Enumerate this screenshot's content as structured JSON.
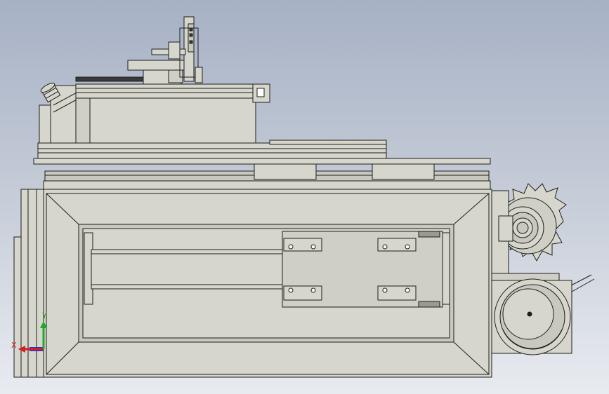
{
  "viewport": {
    "background_top": "#a6b1c5",
    "background_bottom": "#e8ebf0",
    "model_fill": "#d6d6cc",
    "model_edge": "#1e1e1e",
    "model_shade": "#c2c2b8"
  },
  "triad": {
    "x_label": "X",
    "y_label": "Y",
    "x_color": "#d42020",
    "y_color": "#1faa2a",
    "z_color": "#1f35d4"
  },
  "icons": {
    "gear": "gear-icon",
    "pulley": "pulley-icon",
    "nozzle": "nozzle-icon"
  }
}
